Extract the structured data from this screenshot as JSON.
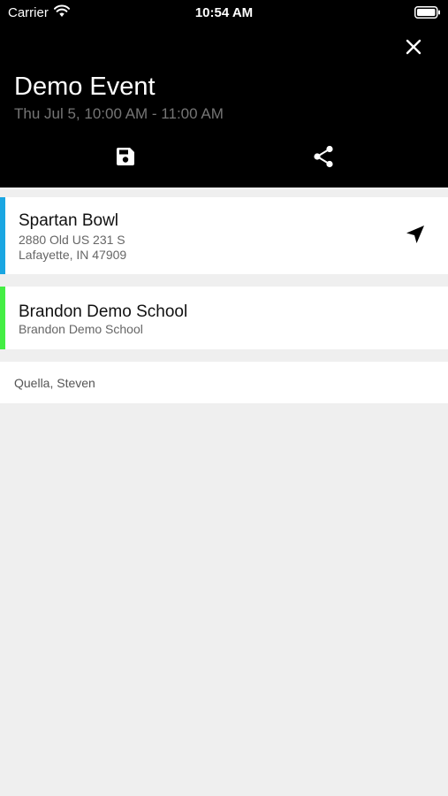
{
  "status_bar": {
    "carrier": "Carrier",
    "time": "10:54 AM"
  },
  "event": {
    "title": "Demo Event",
    "datetime": "Thu Jul 5, 10:00 AM - 11:00 AM"
  },
  "location": {
    "name": "Spartan Bowl",
    "address_line1": "2880 Old US 231 S",
    "address_line2": "Lafayette, IN 47909",
    "stripe_color": "#1aa6e2"
  },
  "school": {
    "name": "Brandon Demo School",
    "subtitle": "Brandon Demo School",
    "stripe_color": "#44ee44"
  },
  "attendee": {
    "name": "Quella, Steven"
  },
  "icons": {
    "close": "close-icon",
    "save": "save-icon",
    "share": "share-icon",
    "navigate": "navigation-arrow-icon"
  }
}
